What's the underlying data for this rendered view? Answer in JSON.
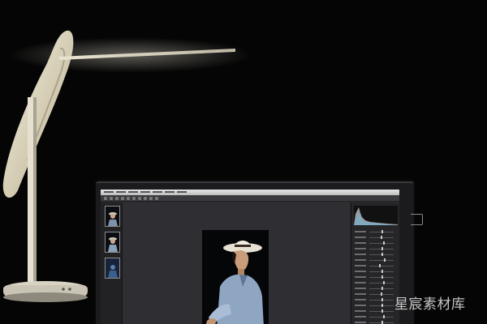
{
  "watermark": {
    "text": "星宸素材库"
  },
  "photo_editor": {
    "menu_items": [
      "",
      "",
      "",
      "",
      "",
      "",
      "",
      "",
      ""
    ],
    "filmstrip_count": 3,
    "panel_sliders": [
      0.5,
      0.45,
      0.55,
      0.5,
      0.5,
      0.6,
      0.4,
      0.5,
      0.5,
      0.55,
      0.5,
      0.45,
      0.5,
      0.5,
      0.5,
      0.55,
      0.5
    ]
  },
  "colors": {
    "background": "#050505",
    "lamp_light": "#f3efe2",
    "screen_ui": "#2a2a2d",
    "watermark": "#d9d9d9"
  },
  "icons": [
    "desk-lamp-icon",
    "monitor-icon",
    "straw-hat-icon"
  ]
}
